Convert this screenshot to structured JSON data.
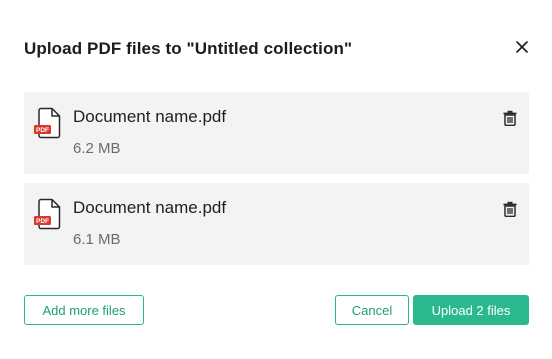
{
  "dialog": {
    "title": "Upload PDF files to \"Untitled collection\"",
    "close_icon": "close-icon"
  },
  "files": [
    {
      "name": "Document name.pdf",
      "size": "6.2 MB",
      "icon": "pdf-file-icon",
      "icon_badge": "PDF",
      "delete_icon": "trash-icon"
    },
    {
      "name": "Document name.pdf",
      "size": "6.1 MB",
      "icon": "pdf-file-icon",
      "icon_badge": "PDF",
      "delete_icon": "trash-icon"
    }
  ],
  "footer": {
    "add_more_label": "Add more files",
    "cancel_label": "Cancel",
    "upload_label": "Upload 2 files"
  },
  "colors": {
    "accent": "#2bb88f",
    "pdf_badge": "#d9382b",
    "card_bg": "#f2f3f2"
  }
}
